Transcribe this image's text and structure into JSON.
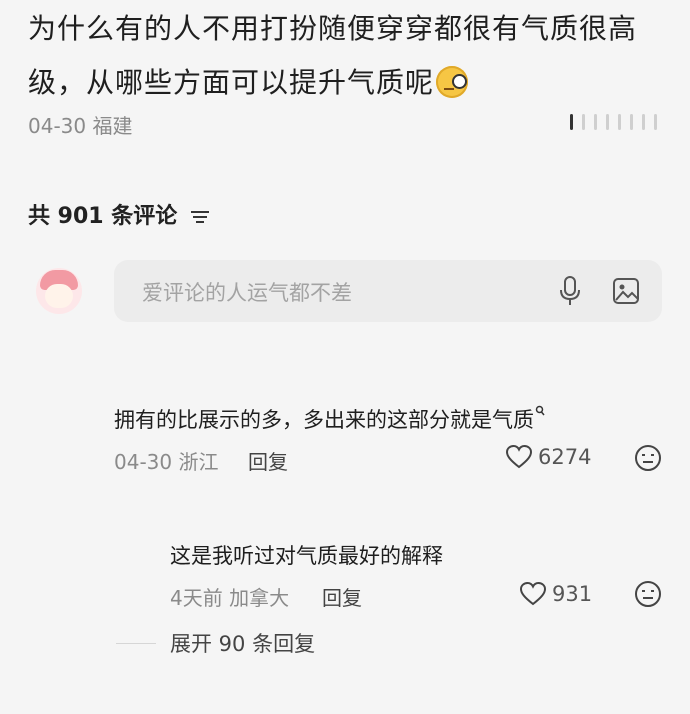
{
  "post": {
    "title": "为什么有的人不用打扮随便穿穿都很有气质很高级，从哪些方面可以提升气质呢",
    "emoji": "thinking-monocle-emoji",
    "date": "04-30",
    "location": "福建"
  },
  "comments_header": {
    "label": "共 901 条评论"
  },
  "input": {
    "placeholder": "爱评论的人运气都不差"
  },
  "comments": [
    {
      "text": "拥有的比展示的多，多出来的这部分就是气质",
      "date": "04-30",
      "location": "浙江",
      "reply_label": "回复",
      "likes": "6274"
    },
    {
      "text": "这是我听过对气质最好的解释",
      "date": "4天前",
      "location": "加拿大",
      "reply_label": "回复",
      "likes": "931"
    }
  ],
  "expand": {
    "label": "展开 90 条回复"
  },
  "colors": {
    "background": "#f5f5f5",
    "text_primary": "#1f1f1f",
    "text_secondary": "#8a8a8a",
    "input_bg": "#ececec"
  }
}
